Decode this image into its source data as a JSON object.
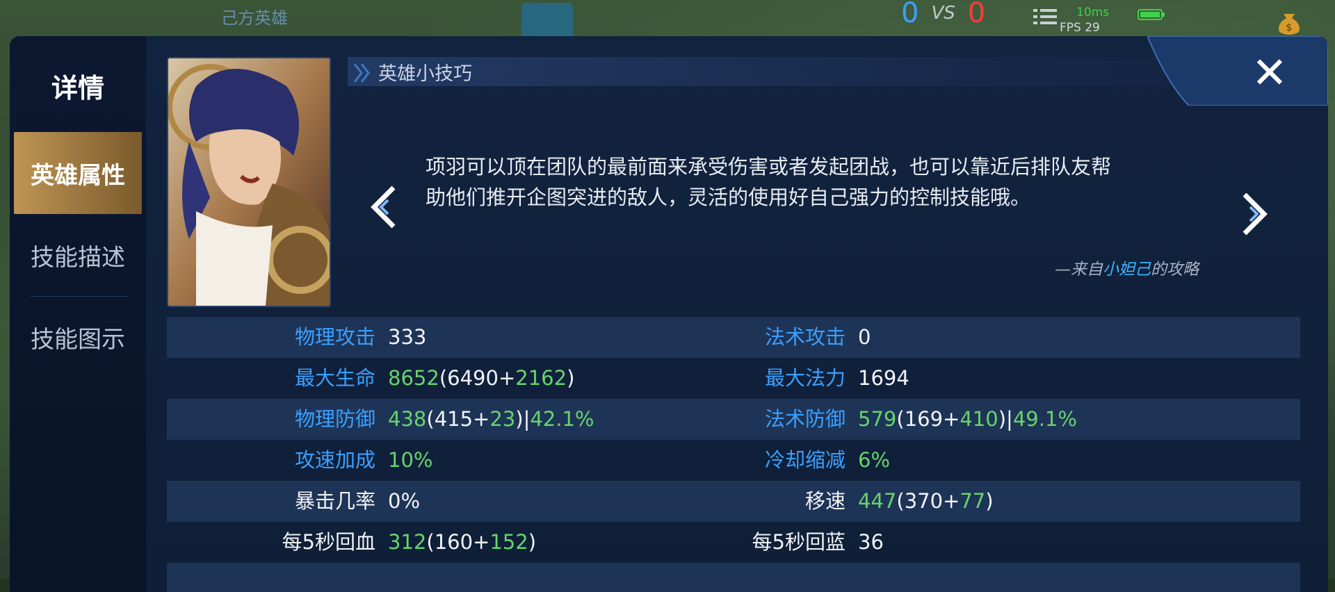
{
  "hud": {
    "ally_title": "己方英雄",
    "score_ally": "0",
    "score_vs": "VS",
    "score_enemy": "0",
    "ping": "10ms",
    "fps": "FPS 29"
  },
  "sidebar": {
    "header": "详情",
    "tabs": [
      {
        "label": "英雄属性",
        "active": true
      },
      {
        "label": "技能描述",
        "active": false
      },
      {
        "label": "技能图示",
        "active": false
      }
    ]
  },
  "tips": {
    "title": "英雄小技巧",
    "body": "项羽可以顶在团队的最前面来承受伤害或者发起团战，也可以靠近后排队友帮助他们推开企图突进的敌人，灵活的使用好自己强力的控制技能哦。",
    "source_prefix": "—来自",
    "source_author": "小妲己",
    "source_suffix": "的攻略"
  },
  "stats": {
    "rows": [
      {
        "left_label": "物理攻击",
        "left_value": "333",
        "right_label": "法术攻击",
        "right_value": "0"
      },
      {
        "left_label": "最大生命",
        "left_total": "8652",
        "left_base": "6490",
        "left_bonus": "2162",
        "right_label": "最大法力",
        "right_value": "1694"
      },
      {
        "left_label": "物理防御",
        "left_total": "438",
        "left_base": "415",
        "left_bonus": "23",
        "left_pct": "42.1%",
        "right_label": "法术防御",
        "right_total": "579",
        "right_base": "169",
        "right_bonus": "410",
        "right_pct": "49.1%"
      },
      {
        "left_label": "攻速加成",
        "left_value": "10%",
        "right_label": "冷却缩减",
        "right_value": "6%"
      },
      {
        "left_label": "暴击几率",
        "left_value": "0%",
        "right_label": "移速",
        "right_total": "447",
        "right_base": "370",
        "right_bonus": "77"
      },
      {
        "left_label": "每5秒回血",
        "left_total": "312",
        "left_base": "160",
        "left_bonus": "152",
        "right_label": "每5秒回蓝",
        "right_value": "36"
      }
    ]
  },
  "colors": {
    "panel_bg": "#0f1d33",
    "active_tab": "#bf9554",
    "label_blue": "#3aa0ff",
    "value_green": "#69d36b",
    "author_blue": "#3eb6ff"
  }
}
